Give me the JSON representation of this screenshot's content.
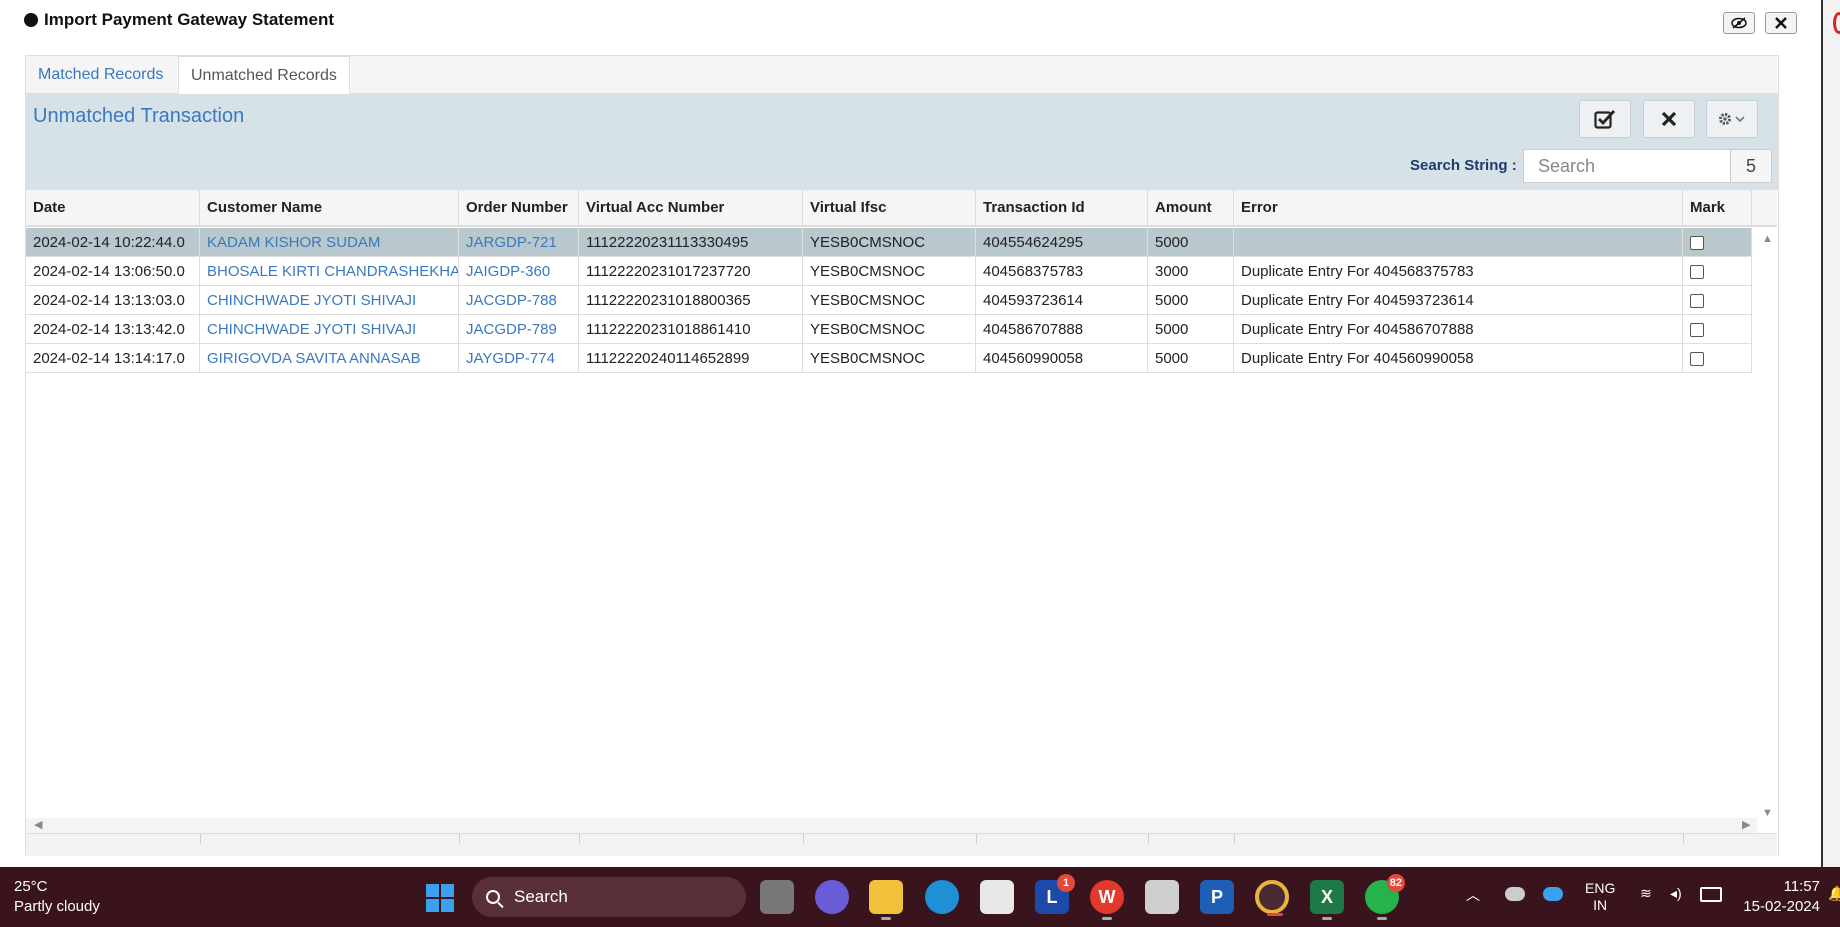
{
  "modal": {
    "title": "Import Payment Gateway Statement",
    "view_icon": "eye-slash-icon",
    "close_icon": "close-icon"
  },
  "tabs": [
    {
      "label": "Matched Records",
      "active": false
    },
    {
      "label": "Unmatched Records",
      "active": true
    }
  ],
  "toolbar": {
    "section_title": "Unmatched Transaction",
    "buttons": [
      "check-square-icon",
      "close-icon",
      "gear-dropdown-icon"
    ],
    "search_label": "Search String :",
    "search_placeholder": "Search",
    "search_value": "",
    "record_count": "5"
  },
  "table": {
    "columns": [
      "Date",
      "Customer Name",
      "Order Number",
      "Virtual Acc Number",
      "Virtual Ifsc",
      "Transaction Id",
      "Amount",
      "Error",
      "Mark"
    ],
    "rows": [
      {
        "date": "2024-02-14 10:22:44.0",
        "customer": "KADAM KISHOR SUDAM",
        "order": "JARGDP-721",
        "vacc": "11122220231113330495",
        "ifsc": "YESB0CMSNOC",
        "txn": "404554624295",
        "amount": "5000",
        "error": "",
        "selected": true
      },
      {
        "date": "2024-02-14 13:06:50.0",
        "customer": "BHOSALE KIRTI CHANDRASHEKHA",
        "order": "JAIGDP-360",
        "vacc": "11122220231017237720",
        "ifsc": "YESB0CMSNOC",
        "txn": "404568375783",
        "amount": "3000",
        "error": "Duplicate Entry For 404568375783",
        "selected": false
      },
      {
        "date": "2024-02-14 13:13:03.0",
        "customer": "CHINCHWADE JYOTI SHIVAJI",
        "order": "JACGDP-788",
        "vacc": "11122220231018800365",
        "ifsc": "YESB0CMSNOC",
        "txn": "404593723614",
        "amount": "5000",
        "error": "Duplicate Entry For 404593723614",
        "selected": false
      },
      {
        "date": "2024-02-14 13:13:42.0",
        "customer": "CHINCHWADE JYOTI SHIVAJI",
        "order": "JACGDP-789",
        "vacc": "11122220231018861410",
        "ifsc": "YESB0CMSNOC",
        "txn": "404586707888",
        "amount": "5000",
        "error": "Duplicate Entry For 404586707888",
        "selected": false
      },
      {
        "date": "2024-02-14 13:14:17.0",
        "customer": "GIRIGOVDA SAVITA ANNASAB",
        "order": "JAYGDP-774",
        "vacc": "11122220240114652899",
        "ifsc": "YESB0CMSNOC",
        "txn": "404560990058",
        "amount": "5000",
        "error": "Duplicate Entry For 404560990058",
        "selected": false
      }
    ]
  },
  "taskbar": {
    "weather_temp": "25°C",
    "weather_desc": "Partly cloudy",
    "search_label": "Search",
    "apps": [
      {
        "name": "task-view-icon"
      },
      {
        "name": "meet-icon"
      },
      {
        "name": "file-explorer-icon"
      },
      {
        "name": "edge-icon"
      },
      {
        "name": "store-icon"
      },
      {
        "name": "app-l-icon",
        "badge": "1"
      },
      {
        "name": "wps-office-icon"
      },
      {
        "name": "window-app-icon"
      },
      {
        "name": "app-p-icon"
      },
      {
        "name": "chrome-icon"
      },
      {
        "name": "excel-icon"
      },
      {
        "name": "whatsapp-icon",
        "badge": "82"
      }
    ],
    "lang_top": "ENG",
    "lang_bottom": "IN",
    "time": "11:57",
    "date": "15-02-2024"
  }
}
